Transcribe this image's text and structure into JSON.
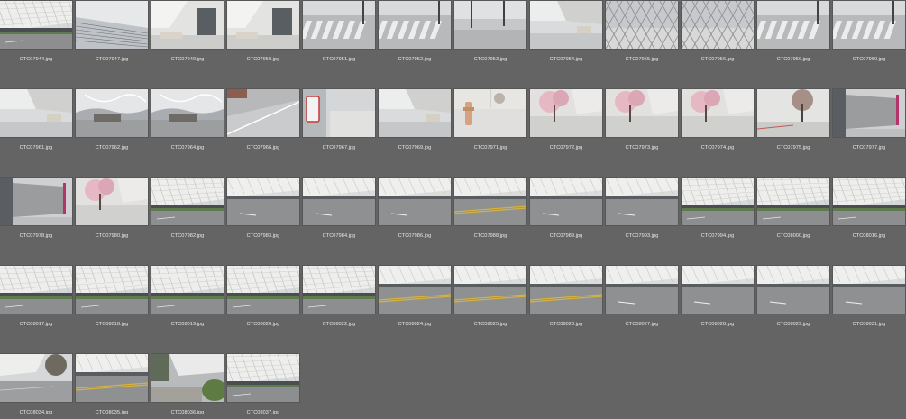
{
  "app": {
    "colors": {
      "background": "#646464",
      "label_text": "#e8e8e8"
    }
  },
  "thumbnails": [
    {
      "filename": "CTC07944.jpg",
      "scene": "facade"
    },
    {
      "filename": "CTC07947.jpg",
      "scene": "glass"
    },
    {
      "filename": "CTC07949.jpg",
      "scene": "building"
    },
    {
      "filename": "CTC07950.jpg",
      "scene": "building"
    },
    {
      "filename": "CTC07951.jpg",
      "scene": "crosswalk"
    },
    {
      "filename": "CTC07952.jpg",
      "scene": "crosswalk"
    },
    {
      "filename": "CTC07953.jpg",
      "scene": "street"
    },
    {
      "filename": "CTC07954.jpg",
      "scene": "plaza"
    },
    {
      "filename": "CTC07955.jpg",
      "scene": "fence"
    },
    {
      "filename": "CTC07956.jpg",
      "scene": "fence"
    },
    {
      "filename": "CTC07959.jpg",
      "scene": "crosswalk"
    },
    {
      "filename": "CTC07960.jpg",
      "scene": "crosswalk"
    },
    {
      "filename": "CTC07961.jpg",
      "scene": "plaza"
    },
    {
      "filename": "CTC07962.jpg",
      "scene": "steel"
    },
    {
      "filename": "CTC07964.jpg",
      "scene": "steel"
    },
    {
      "filename": "CTC07966.jpg",
      "scene": "sidewalk"
    },
    {
      "filename": "CTC07967.jpg",
      "scene": "sign"
    },
    {
      "filename": "CTC07969.jpg",
      "scene": "plaza"
    },
    {
      "filename": "CTC07971.jpg",
      "scene": "hydrant"
    },
    {
      "filename": "CTC07972.jpg",
      "scene": "blossom"
    },
    {
      "filename": "CTC07973.jpg",
      "scene": "blossom"
    },
    {
      "filename": "CTC07974.jpg",
      "scene": "blossom"
    },
    {
      "filename": "CTC07975.jpg",
      "scene": "tree"
    },
    {
      "filename": "CTC07977.jpg",
      "scene": "wall"
    },
    {
      "filename": "CTC07978.jpg",
      "scene": "wall"
    },
    {
      "filename": "CTC07980.jpg",
      "scene": "blossom"
    },
    {
      "filename": "CTC07982.jpg",
      "scene": "facade"
    },
    {
      "filename": "CTC07983.jpg",
      "scene": "road"
    },
    {
      "filename": "CTC07984.jpg",
      "scene": "road"
    },
    {
      "filename": "CTC07986.jpg",
      "scene": "road"
    },
    {
      "filename": "CTC07988.jpg",
      "scene": "road-yellow"
    },
    {
      "filename": "CTC07989.jpg",
      "scene": "road"
    },
    {
      "filename": "CTC07993.jpg",
      "scene": "road"
    },
    {
      "filename": "CTC07994.jpg",
      "scene": "facade"
    },
    {
      "filename": "CTC08000.jpg",
      "scene": "facade"
    },
    {
      "filename": "CTC08016.jpg",
      "scene": "facade"
    },
    {
      "filename": "CTC08017.jpg",
      "scene": "facade"
    },
    {
      "filename": "CTC08018.jpg",
      "scene": "facade"
    },
    {
      "filename": "CTC08019.jpg",
      "scene": "facade"
    },
    {
      "filename": "CTC08020.jpg",
      "scene": "facade"
    },
    {
      "filename": "CTC08022.jpg",
      "scene": "facade"
    },
    {
      "filename": "CTC08024.jpg",
      "scene": "road-yellow"
    },
    {
      "filename": "CTC08025.jpg",
      "scene": "road-yellow"
    },
    {
      "filename": "CTC08026.jpg",
      "scene": "road-yellow"
    },
    {
      "filename": "CTC08027.jpg",
      "scene": "road"
    },
    {
      "filename": "CTC08028.jpg",
      "scene": "road"
    },
    {
      "filename": "CTC08029.jpg",
      "scene": "road"
    },
    {
      "filename": "CTC08031.jpg",
      "scene": "road"
    },
    {
      "filename": "CTC08034.jpg",
      "scene": "tree-corner"
    },
    {
      "filename": "CTC08035.jpg",
      "scene": "road-yellow"
    },
    {
      "filename": "CTC08036.jpg",
      "scene": "hedge"
    },
    {
      "filename": "CTC08037.jpg",
      "scene": "facade"
    }
  ]
}
